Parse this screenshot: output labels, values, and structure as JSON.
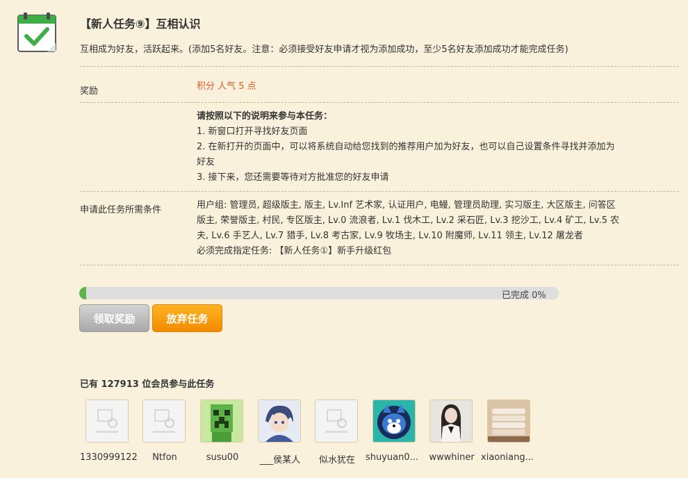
{
  "task": {
    "title": "【新人任务⑨】互相认识",
    "description": "互相成为好友，活跃起来。(添加5名好友。注意：必须接受好友申请才视为添加成功，至少5名好友添加成功才能完成任务)"
  },
  "reward": {
    "label": "奖励",
    "value": "积分 人气 5 点"
  },
  "instructions": {
    "heading": "请按照以下的说明来参与本任务：",
    "steps": [
      "1. 新窗口打开寻找好友页面",
      "2. 在新打开的页面中，可以将系统自动给您找到的推荐用户加为好友，也可以自己设置条件寻找并添加为",
      "好友",
      "3. 接下来，您还需要等待对方批准您的好友申请"
    ]
  },
  "conditions": {
    "label": "申请此任务所需条件",
    "lines": [
      "用户组: 管理员, 超级版主, 版主, Lv.Inf 艺术家, 认证用户, 电鳗, 管理员助理, 实习版主, 大区版主, 问答区",
      "版主, 荣誉版主, 村民, 专区版主, Lv.0 流浪者, Lv.1 伐木工, Lv.2 采石匠, Lv.3 挖沙工, Lv.4 矿工, Lv.5 农",
      "夫, Lv.6 手艺人, Lv.7 猎手, Lv.8 考古家, Lv.9 牧场主, Lv.10 附魔师, Lv.11 领主, Lv.12 屠龙者",
      "必须完成指定任务: 【新人任务①】新手升级红包"
    ]
  },
  "progress": {
    "text": "已完成 0%",
    "value": 0
  },
  "buttons": {
    "claim": "领取奖励",
    "quit": "放弃任务"
  },
  "members": {
    "count_text": "已有 127913 位会员参与此任务",
    "users": [
      {
        "name": "1330999122",
        "avatar": "placeholder-image-icon"
      },
      {
        "name": "Ntfon",
        "avatar": "placeholder-image-icon"
      },
      {
        "name": "susu00",
        "avatar": "creeper-avatar"
      },
      {
        "name": "___侯某人",
        "avatar": "anime-boy-avatar"
      },
      {
        "name": "似水犹在",
        "avatar": "placeholder-image-icon"
      },
      {
        "name": "shuyuan0...",
        "avatar": "wolf-avatar"
      },
      {
        "name": "wwwhiner",
        "avatar": "girl-photo-avatar"
      },
      {
        "name": "xiaoniang...",
        "avatar": "food-photo-avatar"
      }
    ]
  },
  "colors": {
    "background": "#f9f1dc",
    "reward_text": "#e05a2a",
    "progress_fill": "#5fb34a",
    "quit_button": "#f5960a",
    "icon_green": "#3fae49"
  }
}
